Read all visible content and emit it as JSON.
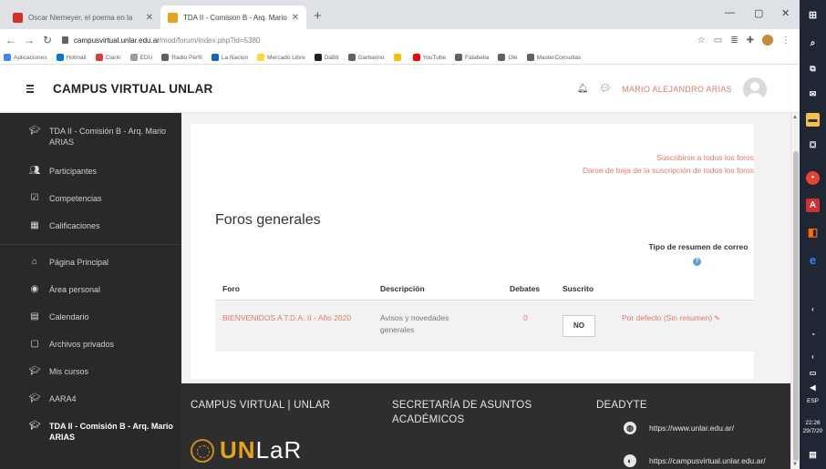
{
  "browser": {
    "tabs": [
      {
        "title": "Oscar Niemeyer, el poema en la",
        "color": "#d93025"
      },
      {
        "title": "TDA II - Comision B - Arq. Mario",
        "color": "#e6a31e"
      }
    ],
    "url_host": "campusvirtual.unlar.edu.ar",
    "url_path": "/mod/forum/index.php?id=5380",
    "bookmarks": [
      {
        "label": "Aplicaciones",
        "color": "#4285f4"
      },
      {
        "label": "Hotmail",
        "color": "#0078d4"
      },
      {
        "label": "Clarin",
        "color": "#e53935"
      },
      {
        "label": "EDU",
        "color": "#9e9e9e"
      },
      {
        "label": "Radio Perfil",
        "color": "#616161"
      },
      {
        "label": "La Nacion",
        "color": "#1565c0"
      },
      {
        "label": "Mercado Libre",
        "color": "#fdd835"
      },
      {
        "label": "DaBti",
        "color": "#212121"
      },
      {
        "label": "Garbarino",
        "color": "#616161"
      },
      {
        "label": "",
        "color": "#fbbc04"
      },
      {
        "label": "YouTube",
        "color": "#ff0000"
      },
      {
        "label": "Falabella",
        "color": "#616161"
      },
      {
        "label": "Ole",
        "color": "#616161"
      },
      {
        "label": "MasterConsultas",
        "color": "#616161"
      }
    ]
  },
  "navbar": {
    "brand": "CAMPUS VIRTUAL UNLAR",
    "user": "MARIO ALEJANDRO ARIAS"
  },
  "sidebar": {
    "items": [
      {
        "icon": "graduation-cap-icon",
        "glyph": "🎓",
        "label": "TDA II - Comisión B - Arq. Mario ARIAS"
      },
      {
        "icon": "users-icon",
        "glyph": "👥",
        "label": "Participantes"
      },
      {
        "icon": "checkbox-icon",
        "glyph": "☑",
        "label": "Competencias"
      },
      {
        "icon": "table-icon",
        "glyph": "▦",
        "label": "Calificaciones"
      },
      {
        "icon": "home-icon",
        "glyph": "⌂",
        "label": "Página Principal"
      },
      {
        "icon": "dashboard-icon",
        "glyph": "◉",
        "label": "Área personal"
      },
      {
        "icon": "calendar-icon",
        "glyph": "▤",
        "label": "Calendario"
      },
      {
        "icon": "file-icon",
        "glyph": "▢",
        "label": "Archivos privados"
      },
      {
        "icon": "graduation-cap-icon",
        "glyph": "🎓",
        "label": "Mis cursos"
      },
      {
        "icon": "graduation-cap-icon",
        "glyph": "🎓",
        "label": "AARA4"
      },
      {
        "icon": "graduation-cap-icon",
        "glyph": "🎓",
        "label": "TDA II - Comisión B - Arq. Mario ARIAS"
      }
    ]
  },
  "main": {
    "subscribe_all": "Suscribirse a todos los foros",
    "unsubscribe_all": "Darse de baja de la suscripción de todos los foros",
    "title": "Foros generales",
    "digest_header": "Tipo de resumen de correo",
    "columns": {
      "forum": "Foro",
      "description": "Descripción",
      "debates": "Debates",
      "subscribed": "Suscrito"
    },
    "row": {
      "forum": "BIENVENIDOS A T.D.A. II - Año 2020",
      "description": "Avisos y novedades generales",
      "debates": "0",
      "subscribed": "NO",
      "digest": "Por defecto (Sin resumen)"
    }
  },
  "footer": {
    "col1": "CAMPUS VIRTUAL | UNLAR",
    "col2": "SECRETARÍA DE ASUNTOS ACADÉMICOS",
    "col3": "DEADYTE",
    "logo_un": "UN",
    "logo_rest": "LaR",
    "link1": "https://www.unlar.edu.ar/",
    "link2": "https://campusvirtual.unlar.edu.ar/"
  },
  "taskbar": {
    "keyboard": "ESP",
    "time": "22:26",
    "date": "29/7/20"
  }
}
